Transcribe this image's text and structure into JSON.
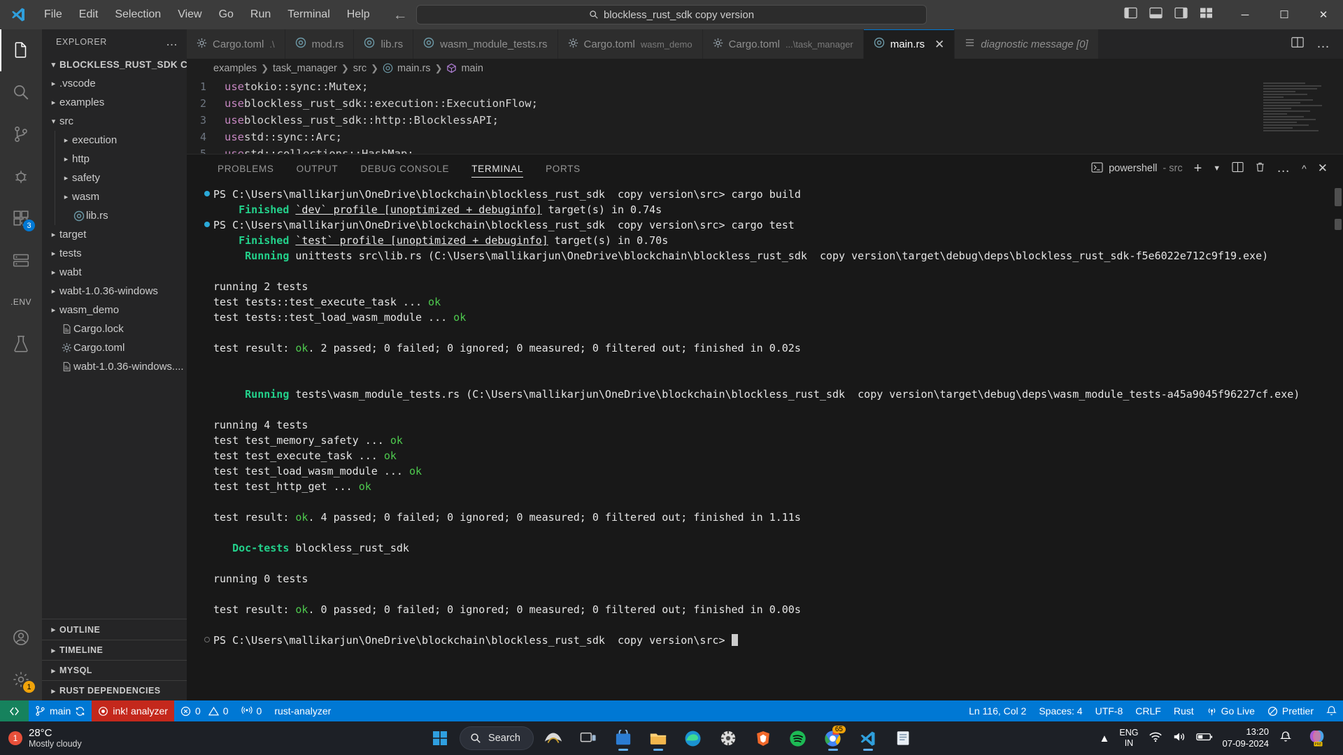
{
  "titlebar": {
    "menus": [
      "File",
      "Edit",
      "Selection",
      "View",
      "Go",
      "Run",
      "Terminal",
      "Help"
    ],
    "command_center_text": "blockless_rust_sdk copy version",
    "search_icon": "search-icon",
    "back_icon": "arrow-left-icon",
    "forward_icon": "arrow-right-icon",
    "layout_icons": [
      "toggle-primary-sidebar-icon",
      "toggle-panel-icon",
      "toggle-secondary-sidebar-icon",
      "customize-layout-icon"
    ],
    "window_minimize": "─",
    "window_maximize": "☐",
    "window_close": "✕"
  },
  "activitybar": {
    "items": [
      {
        "name": "explorer",
        "icon": "files-icon",
        "active": true,
        "badge": ""
      },
      {
        "name": "search",
        "icon": "search-icon",
        "active": false,
        "badge": ""
      },
      {
        "name": "source-control",
        "icon": "source-control-icon",
        "active": false,
        "badge": ""
      },
      {
        "name": "run-and-debug",
        "icon": "debug-icon",
        "active": false,
        "badge": ""
      },
      {
        "name": "extensions",
        "icon": "extensions-icon",
        "active": false,
        "badge": "3"
      },
      {
        "name": "remote-explorer",
        "icon": "remote-explorer-icon",
        "active": false,
        "badge": ""
      },
      {
        "name": "dotenv",
        "icon": "env-icon",
        "active": false,
        "badge": ""
      },
      {
        "name": "test-explorer",
        "icon": "beaker-icon",
        "active": false,
        "badge": ""
      }
    ],
    "bottom": [
      {
        "name": "accounts",
        "icon": "account-icon",
        "badge": ""
      },
      {
        "name": "settings",
        "icon": "gear-icon",
        "badge": "1"
      }
    ]
  },
  "sidebar": {
    "title": "EXPLORER",
    "more_actions": "…",
    "root": {
      "label": "BLOCKLESS_RUST_SDK CO...",
      "expanded": true
    },
    "tree": [
      {
        "label": ".vscode",
        "type": "folder",
        "expanded": false,
        "depth": 1
      },
      {
        "label": "examples",
        "type": "folder",
        "expanded": false,
        "depth": 1
      },
      {
        "label": "src",
        "type": "folder",
        "expanded": true,
        "depth": 1
      },
      {
        "label": "execution",
        "type": "folder",
        "expanded": false,
        "depth": 2
      },
      {
        "label": "http",
        "type": "folder",
        "expanded": false,
        "depth": 2
      },
      {
        "label": "safety",
        "type": "folder",
        "expanded": false,
        "depth": 2
      },
      {
        "label": "wasm",
        "type": "folder",
        "expanded": false,
        "depth": 2
      },
      {
        "label": "lib.rs",
        "type": "rust",
        "depth": 2
      },
      {
        "label": "target",
        "type": "folder",
        "expanded": false,
        "depth": 1
      },
      {
        "label": "tests",
        "type": "folder",
        "expanded": false,
        "depth": 1
      },
      {
        "label": "wabt",
        "type": "folder",
        "expanded": false,
        "depth": 1
      },
      {
        "label": "wabt-1.0.36-windows",
        "type": "folder",
        "expanded": false,
        "depth": 1
      },
      {
        "label": "wasm_demo",
        "type": "folder",
        "expanded": false,
        "depth": 1
      },
      {
        "label": "Cargo.lock",
        "type": "file",
        "depth": 1
      },
      {
        "label": "Cargo.toml",
        "type": "toml",
        "depth": 1
      },
      {
        "label": "wabt-1.0.36-windows....",
        "type": "file",
        "depth": 1
      }
    ],
    "panels": [
      "OUTLINE",
      "TIMELINE",
      "MYSQL",
      "RUST DEPENDENCIES"
    ]
  },
  "tabs": [
    {
      "label": "Cargo.toml",
      "desc": ".\\",
      "icon": "toml-icon",
      "active": false,
      "italic": false,
      "close": false
    },
    {
      "label": "mod.rs",
      "desc": "",
      "icon": "rust-icon",
      "active": false,
      "italic": false,
      "close": false
    },
    {
      "label": "lib.rs",
      "desc": "",
      "icon": "rust-icon",
      "active": false,
      "italic": false,
      "close": false
    },
    {
      "label": "wasm_module_tests.rs",
      "desc": "",
      "icon": "rust-icon",
      "active": false,
      "italic": false,
      "close": false
    },
    {
      "label": "Cargo.toml",
      "desc": "wasm_demo",
      "icon": "toml-icon",
      "active": false,
      "italic": false,
      "close": false
    },
    {
      "label": "Cargo.toml",
      "desc": "...\\task_manager",
      "icon": "toml-icon",
      "active": false,
      "italic": false,
      "close": false
    },
    {
      "label": "main.rs",
      "desc": "",
      "icon": "rust-icon",
      "active": true,
      "italic": false,
      "close": true
    },
    {
      "label": "diagnostic message [0]",
      "desc": "",
      "icon": "list-icon",
      "active": false,
      "italic": true,
      "close": false
    }
  ],
  "tabbar_actions": {
    "split_editor": "split-editor-icon",
    "more": "…"
  },
  "breadcrumb": [
    {
      "label": "examples",
      "icon": ""
    },
    {
      "label": "task_manager",
      "icon": ""
    },
    {
      "label": "src",
      "icon": ""
    },
    {
      "label": "main.rs",
      "icon": "rust-icon"
    },
    {
      "label": "main",
      "icon": "symbol-method-icon"
    }
  ],
  "code": {
    "lines": [
      {
        "no": "1",
        "kw": "use",
        "rest": " tokio::sync::Mutex;"
      },
      {
        "no": "2",
        "kw": "use",
        "rest": " blockless_rust_sdk::execution::ExecutionFlow;"
      },
      {
        "no": "3",
        "kw": "use",
        "rest": " blockless_rust_sdk::http::BlocklessAPI;"
      },
      {
        "no": "4",
        "kw": "use",
        "rest": " std::sync::Arc;"
      },
      {
        "no": "5",
        "kw": "use",
        "rest": " std::collections::HashMap;"
      }
    ]
  },
  "panel": {
    "tabs": [
      "PROBLEMS",
      "OUTPUT",
      "DEBUG CONSOLE",
      "TERMINAL",
      "PORTS"
    ],
    "active_tab": "TERMINAL",
    "shell": {
      "icon": "terminal-powershell-icon",
      "name": "powershell",
      "desc": "- src"
    },
    "actions": [
      "new-terminal-icon",
      "chevron-down-icon",
      "split-terminal-icon",
      "kill-terminal-icon",
      "more-actions-icon",
      "maximize-panel-icon",
      "close-panel-icon"
    ]
  },
  "terminal": {
    "prompt_prefix": "PS C:\\Users\\mallikarjun\\OneDrive\\blockchain\\blockless_rust_sdk  copy version\\src>",
    "lines": [
      {
        "gutter": "dot",
        "parts": [
          {
            "t": "PS C:\\Users\\mallikarjun\\OneDrive\\blockchain\\blockless_rust_sdk  copy version\\src> ",
            "c": "white"
          },
          {
            "t": "cargo build",
            "c": "white"
          }
        ]
      },
      {
        "gutter": "",
        "parts": [
          {
            "t": "    ",
            "c": "white"
          },
          {
            "t": "Finished",
            "c": "green-b"
          },
          {
            "t": " ",
            "c": "white"
          },
          {
            "t": "`dev` profile [unoptimized + debuginfo]",
            "c": "ul"
          },
          {
            "t": " target(s) in 0.74s",
            "c": "white"
          }
        ]
      },
      {
        "gutter": "dot",
        "parts": [
          {
            "t": "PS C:\\Users\\mallikarjun\\OneDrive\\blockchain\\blockless_rust_sdk  copy version\\src> ",
            "c": "white"
          },
          {
            "t": "cargo test",
            "c": "white"
          }
        ]
      },
      {
        "gutter": "",
        "parts": [
          {
            "t": "    ",
            "c": "white"
          },
          {
            "t": "Finished",
            "c": "green-b"
          },
          {
            "t": " ",
            "c": "white"
          },
          {
            "t": "`test` profile [unoptimized + debuginfo]",
            "c": "ul"
          },
          {
            "t": " target(s) in 0.70s",
            "c": "white"
          }
        ]
      },
      {
        "gutter": "",
        "parts": [
          {
            "t": "     ",
            "c": "white"
          },
          {
            "t": "Running",
            "c": "green-b"
          },
          {
            "t": " unittests src\\lib.rs (C:\\Users\\mallikarjun\\OneDrive\\blockchain\\blockless_rust_sdk  copy version\\target\\debug\\deps\\blockless_rust_sdk-f5e6022e712c9f19.exe)",
            "c": "white"
          }
        ]
      },
      {
        "gutter": "",
        "parts": [
          {
            "t": "",
            "c": "white"
          }
        ]
      },
      {
        "gutter": "",
        "parts": [
          {
            "t": "running 2 tests",
            "c": "white"
          }
        ]
      },
      {
        "gutter": "",
        "parts": [
          {
            "t": "test tests::test_execute_task ... ",
            "c": "white"
          },
          {
            "t": "ok",
            "c": "green"
          }
        ]
      },
      {
        "gutter": "",
        "parts": [
          {
            "t": "test tests::test_load_wasm_module ... ",
            "c": "white"
          },
          {
            "t": "ok",
            "c": "green"
          }
        ]
      },
      {
        "gutter": "",
        "parts": [
          {
            "t": "",
            "c": "white"
          }
        ]
      },
      {
        "gutter": "",
        "parts": [
          {
            "t": "test result: ",
            "c": "white"
          },
          {
            "t": "ok",
            "c": "green"
          },
          {
            "t": ". 2 passed; 0 failed; 0 ignored; 0 measured; 0 filtered out; finished in 0.02s",
            "c": "white"
          }
        ]
      },
      {
        "gutter": "",
        "parts": [
          {
            "t": "",
            "c": "white"
          }
        ]
      },
      {
        "gutter": "",
        "parts": [
          {
            "t": "",
            "c": "white"
          }
        ]
      },
      {
        "gutter": "",
        "parts": [
          {
            "t": "     ",
            "c": "white"
          },
          {
            "t": "Running",
            "c": "green-b"
          },
          {
            "t": " tests\\wasm_module_tests.rs (C:\\Users\\mallikarjun\\OneDrive\\blockchain\\blockless_rust_sdk  copy version\\target\\debug\\deps\\wasm_module_tests-a45a9045f96227cf.exe)",
            "c": "white"
          }
        ]
      },
      {
        "gutter": "",
        "parts": [
          {
            "t": "",
            "c": "white"
          }
        ]
      },
      {
        "gutter": "",
        "parts": [
          {
            "t": "running 4 tests",
            "c": "white"
          }
        ]
      },
      {
        "gutter": "",
        "parts": [
          {
            "t": "test test_memory_safety ... ",
            "c": "white"
          },
          {
            "t": "ok",
            "c": "green"
          }
        ]
      },
      {
        "gutter": "",
        "parts": [
          {
            "t": "test test_execute_task ... ",
            "c": "white"
          },
          {
            "t": "ok",
            "c": "green"
          }
        ]
      },
      {
        "gutter": "",
        "parts": [
          {
            "t": "test test_load_wasm_module ... ",
            "c": "white"
          },
          {
            "t": "ok",
            "c": "green"
          }
        ]
      },
      {
        "gutter": "",
        "parts": [
          {
            "t": "test test_http_get ... ",
            "c": "white"
          },
          {
            "t": "ok",
            "c": "green"
          }
        ]
      },
      {
        "gutter": "",
        "parts": [
          {
            "t": "",
            "c": "white"
          }
        ]
      },
      {
        "gutter": "",
        "parts": [
          {
            "t": "test result: ",
            "c": "white"
          },
          {
            "t": "ok",
            "c": "green"
          },
          {
            "t": ". 4 passed; 0 failed; 0 ignored; 0 measured; 0 filtered out; finished in 1.11s",
            "c": "white"
          }
        ]
      },
      {
        "gutter": "",
        "parts": [
          {
            "t": "",
            "c": "white"
          }
        ]
      },
      {
        "gutter": "",
        "parts": [
          {
            "t": "   ",
            "c": "white"
          },
          {
            "t": "Doc-tests",
            "c": "green-b"
          },
          {
            "t": " blockless_rust_sdk",
            "c": "white"
          }
        ]
      },
      {
        "gutter": "",
        "parts": [
          {
            "t": "",
            "c": "white"
          }
        ]
      },
      {
        "gutter": "",
        "parts": [
          {
            "t": "running 0 tests",
            "c": "white"
          }
        ]
      },
      {
        "gutter": "",
        "parts": [
          {
            "t": "",
            "c": "white"
          }
        ]
      },
      {
        "gutter": "",
        "parts": [
          {
            "t": "test result: ",
            "c": "white"
          },
          {
            "t": "ok",
            "c": "green"
          },
          {
            "t": ". 0 passed; 0 failed; 0 ignored; 0 measured; 0 filtered out; finished in 0.00s",
            "c": "white"
          }
        ]
      },
      {
        "gutter": "",
        "parts": [
          {
            "t": "",
            "c": "white"
          }
        ]
      },
      {
        "gutter": "hollow",
        "parts": [
          {
            "t": "PS C:\\Users\\mallikarjun\\OneDrive\\blockchain\\blockless_rust_sdk  copy version\\src> ",
            "c": "white"
          },
          {
            "t": "CURSOR",
            "c": "cursor"
          }
        ]
      }
    ]
  },
  "statusbar": {
    "remote_icon": "remote-window-icon",
    "branch": {
      "icon": "source-control-icon",
      "label": "main",
      "sync_icon": "sync-icon"
    },
    "analyzer": {
      "icon": "record-icon",
      "label": "ink! analyzer"
    },
    "errors": {
      "icon": "error-icon",
      "count": "0"
    },
    "warnings": {
      "icon": "warning-icon",
      "count": "0"
    },
    "radio": {
      "icon": "radio-tower-icon",
      "count": "0"
    },
    "rust_analyzer": "rust-analyzer",
    "right": {
      "position": "Ln 116, Col 2",
      "spaces": "Spaces: 4",
      "encoding": "UTF-8",
      "eol": "CRLF",
      "language": "Rust",
      "golive": "Go Live",
      "prettier": "Prettier",
      "bell_icon": "bell-icon"
    }
  },
  "taskbar": {
    "weather": {
      "badge": "1",
      "temp": "28°C",
      "cond": "Mostly cloudy"
    },
    "start_icon": "windows-start-icon",
    "search_placeholder": "Search",
    "search_icon": "search-icon",
    "apps": [
      {
        "name": "copilot",
        "icon": "copilot-icon"
      },
      {
        "name": "task-view",
        "icon": "task-view-icon"
      },
      {
        "name": "microsoft-store",
        "icon": "store-icon"
      },
      {
        "name": "file-explorer",
        "icon": "folder-icon"
      },
      {
        "name": "edge",
        "icon": "edge-icon"
      },
      {
        "name": "settings",
        "icon": "settings-icon"
      },
      {
        "name": "brave",
        "icon": "brave-icon"
      },
      {
        "name": "spotify",
        "icon": "spotify-icon"
      },
      {
        "name": "chrome",
        "icon": "chrome-icon",
        "badge": "65"
      },
      {
        "name": "vscode",
        "icon": "vscode-icon"
      },
      {
        "name": "notepad",
        "icon": "notepad-icon"
      }
    ],
    "tray": {
      "chevron": "chevron-up-icon",
      "lang1": "ENG",
      "lang2": "IN",
      "wifi_icon": "wifi-icon",
      "volume_icon": "volume-icon",
      "battery_icon": "battery-icon",
      "time": "13:20",
      "date": "07-09-2024",
      "notif_icon": "bell-sleep-icon",
      "copilot_badge": "PRE"
    }
  },
  "colors": {
    "accent": "#0078d4",
    "remote_green": "#16825d",
    "analyzer_red": "#c4281c",
    "editor_bg": "#1e1e1e",
    "terminal_bg": "#181818",
    "sidebar_bg": "#252526"
  }
}
